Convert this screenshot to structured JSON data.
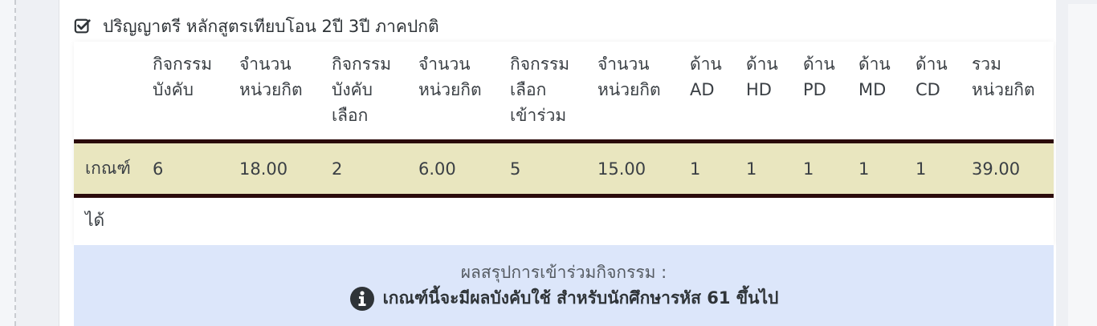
{
  "section": {
    "title": "ปริญญาตรี หลักสูตรเทียบโอน 2ปี 3ปี ภาคปกติ",
    "checked": true
  },
  "table": {
    "columns": [
      [
        "กิจกรรม",
        "บังคับ"
      ],
      [
        "จำนวน",
        "หน่วยกิต"
      ],
      [
        "กิจกรรม",
        "บังคับ",
        "เลือก"
      ],
      [
        "จำนวน",
        "หน่วยกิต"
      ],
      [
        "กิจกรรม",
        "เลือก",
        "เข้าร่วม"
      ],
      [
        "จำนวน",
        "หน่วยกิต"
      ],
      [
        "ด้าน",
        "AD"
      ],
      [
        "ด้าน",
        "HD"
      ],
      [
        "ด้าน",
        "PD"
      ],
      [
        "ด้าน",
        "MD"
      ],
      [
        "ด้าน",
        "CD"
      ],
      [
        "รวม",
        "หน่วยกิต"
      ]
    ],
    "row": {
      "label": "เกณฑ์",
      "values": [
        "6",
        "18.00",
        "2",
        "6.00",
        "5",
        "15.00",
        "1",
        "1",
        "1",
        "1",
        "1",
        "39.00"
      ]
    },
    "row_label_wrap": "ได้"
  },
  "summary": {
    "title": "ผลสรุปการเข้าร่วมกิจกรรม :",
    "note": "เกณฑ์นี้จะมีผลบังคับใช้ สำหรับนักศึกษารหัส 61 ขึ้นไป",
    "icon": "info-circle-icon"
  },
  "colors": {
    "row_bg": "#e9e6bf",
    "row_border": "#2b0b0b",
    "summary_bg": "#dce6fa"
  }
}
